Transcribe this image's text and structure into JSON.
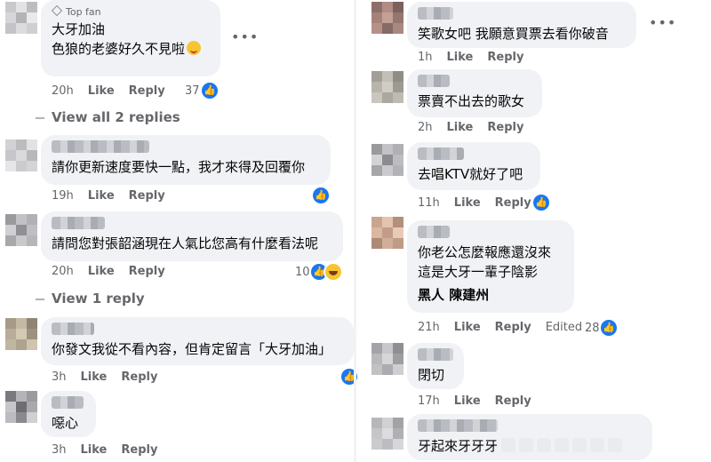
{
  "left": {
    "c1": {
      "badge": "Top fan",
      "lines": [
        "大牙加油",
        "色狼的老婆好久不見啦"
      ],
      "time": "20h",
      "like": "Like",
      "reply": "Reply",
      "count": "37"
    },
    "view_all": "View all 2 replies",
    "c2": {
      "lines": [
        "請你更新速度要快一點，我才來得及回覆你"
      ],
      "time": "19h",
      "like": "Like",
      "reply": "Reply"
    },
    "c3": {
      "lines": [
        "請問您對張韶涵現在人氣比您高有什麼看法呢"
      ],
      "time": "20h",
      "like": "Like",
      "reply": "Reply",
      "count": "10"
    },
    "view_one": "View 1 reply",
    "c4": {
      "lines": [
        "你發文我從不看內容，但肯定留言「大牙加油」"
      ],
      "time": "3h",
      "like": "Like",
      "reply": "Reply"
    },
    "c5": {
      "lines": [
        "噁心"
      ],
      "time": "3h",
      "like": "Like",
      "reply": "Reply"
    }
  },
  "right": {
    "c1": {
      "lines": [
        "笑歌女吧 我願意買票去看你破音"
      ],
      "time": "1h",
      "like": "Like",
      "reply": "Reply"
    },
    "c2": {
      "lines": [
        "票賣不出去的歌女"
      ],
      "time": "2h",
      "like": "Like",
      "reply": "Reply"
    },
    "c3": {
      "lines": [
        "去唱KTV就好了吧"
      ],
      "time": "11h",
      "like": "Like",
      "reply": "Reply"
    },
    "c4": {
      "lines": [
        "你老公怎麼報應還沒來",
        "這是大牙一輩子陰影",
        "黑人 陳建州"
      ],
      "time": "21h",
      "like": "Like",
      "reply": "Reply",
      "edited": "Edited",
      "count": "28"
    },
    "c5": {
      "lines": [
        "閉切"
      ],
      "time": "17h",
      "like": "Like",
      "reply": "Reply"
    },
    "c6": {
      "lines": [
        "牙起來牙牙牙"
      ],
      "time": "",
      "like": "",
      "reply": ""
    }
  },
  "icons": {
    "like": "thumbs-up-icon",
    "haha": "haha-emoji-icon",
    "more": "more-options-icon",
    "top_fan": "top-fan-diamond-icon"
  },
  "colors": {
    "bubble": "#f0f2f5",
    "like_blue": "#1877f2",
    "meta_gray": "#65676b"
  }
}
